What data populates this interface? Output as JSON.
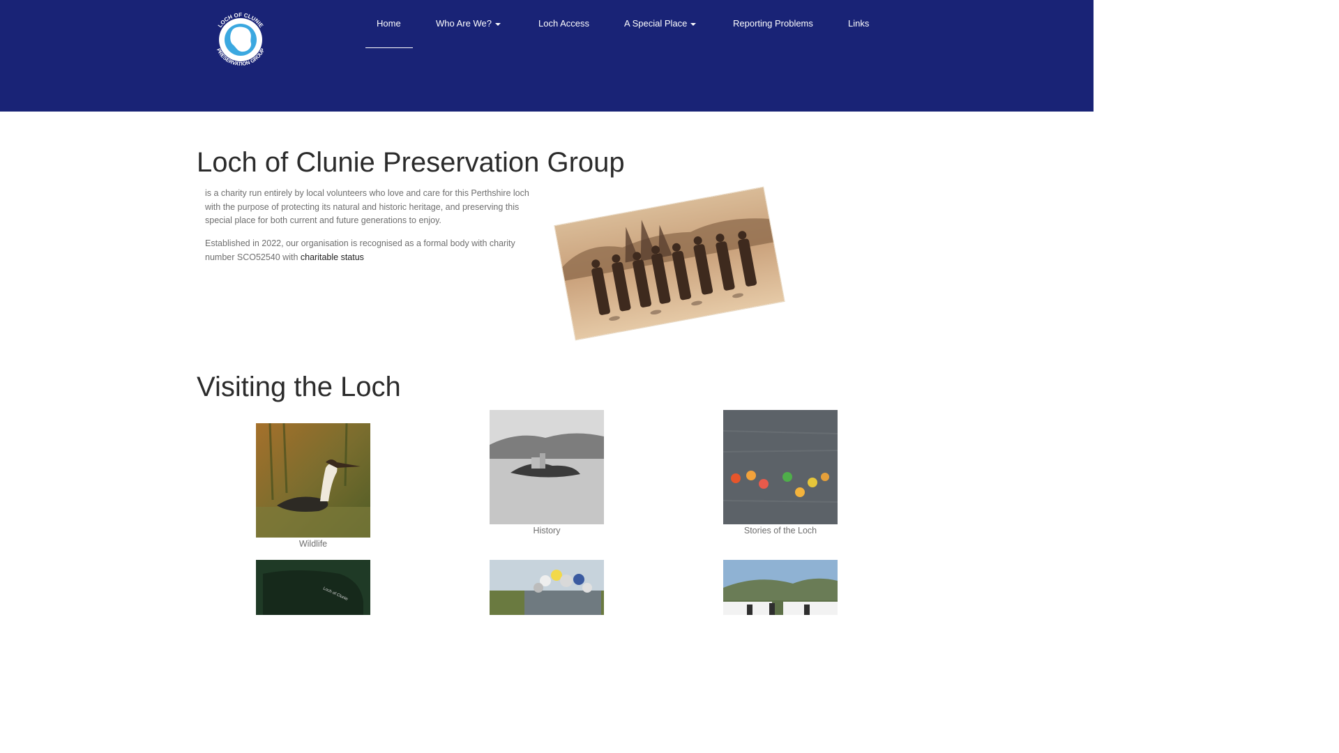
{
  "site": {
    "logo_alt": "Loch of Clunie Preservation Group logo",
    "logo_text_top": "LOCH OF CLUNIE",
    "logo_text_bottom": "PRESERVATION GROUP"
  },
  "nav": {
    "items": [
      {
        "label": "Home",
        "has_dropdown": false,
        "active": true
      },
      {
        "label": "Who Are We?",
        "has_dropdown": true,
        "active": false
      },
      {
        "label": "Loch Access",
        "has_dropdown": false,
        "active": false
      },
      {
        "label": "A Special Place",
        "has_dropdown": true,
        "active": false
      },
      {
        "label": "Reporting Problems",
        "has_dropdown": false,
        "active": false
      },
      {
        "label": "Links",
        "has_dropdown": false,
        "active": false
      }
    ]
  },
  "intro": {
    "title": "Loch of Clunie Preservation Group",
    "paragraph1": "is a charity run entirely by local volunteers who love and care for this Perthshire loch with the purpose of protecting its natural and historic heritage, and preserving this special place for both current and future generations to enjoy.",
    "paragraph2_text": "Established in 2022, our organisation is recognised as a formal body with charity number SCO52540 with ",
    "paragraph2_link": "charitable status"
  },
  "visiting": {
    "title": "Visiting the Loch",
    "tiles": [
      {
        "caption": "Wildlife"
      },
      {
        "caption": "History"
      },
      {
        "caption": "Stories of the Loch"
      },
      {
        "caption": ""
      },
      {
        "caption": ""
      },
      {
        "caption": ""
      }
    ]
  },
  "colors": {
    "header_bg": "#192376",
    "text_heading": "#2b2b2b",
    "text_body": "#6e6e6e"
  }
}
